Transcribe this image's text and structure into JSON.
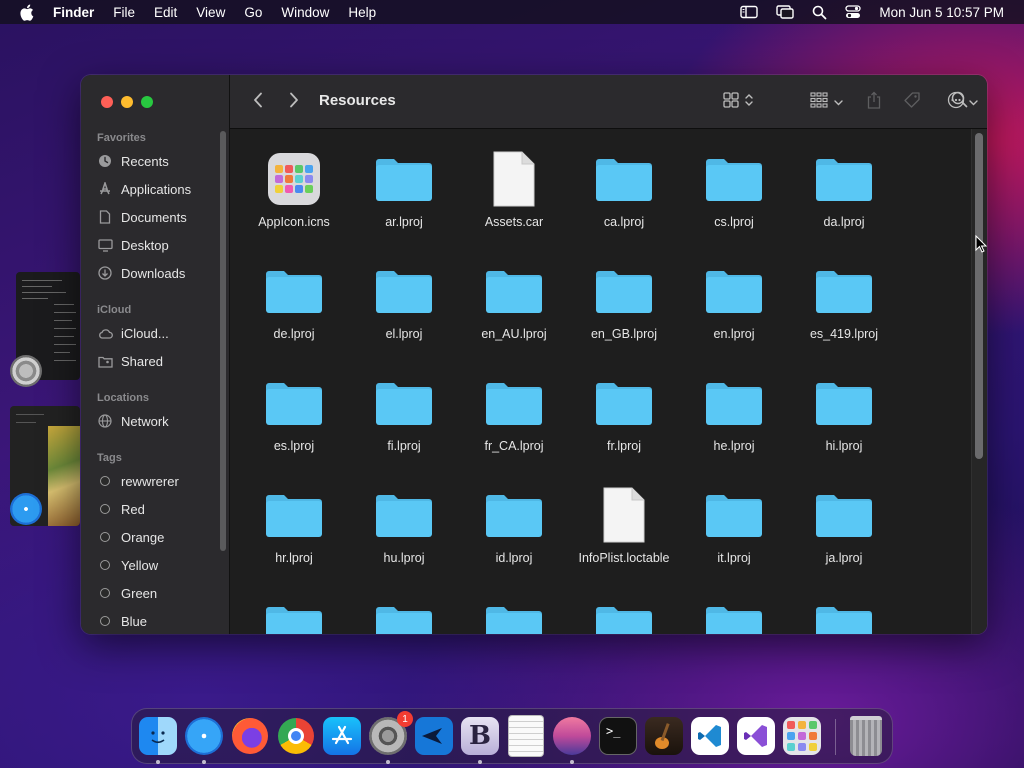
{
  "menubar": {
    "app_name": "Finder",
    "menus": [
      "File",
      "Edit",
      "View",
      "Go",
      "Window",
      "Help"
    ],
    "clock": "Mon Jun 5  10:57 PM",
    "status_icons": [
      "sidebar-list-icon",
      "screen-mirroring-icon",
      "spotlight-search-icon",
      "control-center-icon"
    ]
  },
  "window": {
    "title": "Resources"
  },
  "sidebar": {
    "favorites_header": "Favorites",
    "favorites": [
      {
        "label": "Recents",
        "icon": "clock-icon"
      },
      {
        "label": "Applications",
        "icon": "applications-icon"
      },
      {
        "label": "Documents",
        "icon": "document-icon"
      },
      {
        "label": "Desktop",
        "icon": "desktop-icon"
      },
      {
        "label": "Downloads",
        "icon": "download-icon"
      }
    ],
    "icloud_header": "iCloud",
    "icloud": [
      {
        "label": "iCloud...",
        "icon": "cloud-icon"
      },
      {
        "label": "Shared",
        "icon": "shared-folder-icon"
      }
    ],
    "locations_header": "Locations",
    "locations": [
      {
        "label": "Network",
        "icon": "globe-icon"
      }
    ],
    "tags_header": "Tags",
    "tags": [
      {
        "label": "rewwrerer"
      },
      {
        "label": "Red"
      },
      {
        "label": "Orange"
      },
      {
        "label": "Yellow"
      },
      {
        "label": "Green"
      },
      {
        "label": "Blue"
      }
    ]
  },
  "files": [
    {
      "name": "AppIcon.icns",
      "kind": "icns"
    },
    {
      "name": "ar.lproj",
      "kind": "folder"
    },
    {
      "name": "Assets.car",
      "kind": "document"
    },
    {
      "name": "ca.lproj",
      "kind": "folder"
    },
    {
      "name": "cs.lproj",
      "kind": "folder"
    },
    {
      "name": "da.lproj",
      "kind": "folder"
    },
    {
      "name": "de.lproj",
      "kind": "folder"
    },
    {
      "name": "el.lproj",
      "kind": "folder"
    },
    {
      "name": "en_AU.lproj",
      "kind": "folder"
    },
    {
      "name": "en_GB.lproj",
      "kind": "folder"
    },
    {
      "name": "en.lproj",
      "kind": "folder"
    },
    {
      "name": "es_419.lproj",
      "kind": "folder"
    },
    {
      "name": "es.lproj",
      "kind": "folder"
    },
    {
      "name": "fi.lproj",
      "kind": "folder"
    },
    {
      "name": "fr_CA.lproj",
      "kind": "folder"
    },
    {
      "name": "fr.lproj",
      "kind": "folder"
    },
    {
      "name": "he.lproj",
      "kind": "folder"
    },
    {
      "name": "hi.lproj",
      "kind": "folder"
    },
    {
      "name": "hr.lproj",
      "kind": "folder"
    },
    {
      "name": "hu.lproj",
      "kind": "folder"
    },
    {
      "name": "id.lproj",
      "kind": "folder"
    },
    {
      "name": "InfoPlist.loctable",
      "kind": "document"
    },
    {
      "name": "it.lproj",
      "kind": "folder"
    },
    {
      "name": "ja.lproj",
      "kind": "folder"
    },
    {
      "name": "",
      "kind": "folder"
    },
    {
      "name": "",
      "kind": "folder"
    },
    {
      "name": "",
      "kind": "folder"
    },
    {
      "name": "",
      "kind": "folder"
    },
    {
      "name": "",
      "kind": "folder"
    },
    {
      "name": "",
      "kind": "folder"
    }
  ],
  "dock": {
    "apps": [
      {
        "name": "finder-icon",
        "running": true
      },
      {
        "name": "safari-icon",
        "running": true
      },
      {
        "name": "firefox-icon",
        "running": false
      },
      {
        "name": "chrome-icon",
        "running": false
      },
      {
        "name": "app-store-icon",
        "running": false
      },
      {
        "name": "system-settings-icon",
        "running": true,
        "badge": "1"
      },
      {
        "name": "xcode-instruments-icon",
        "running": false
      },
      {
        "name": "bbedit-icon",
        "running": true
      },
      {
        "name": "textedit-icon",
        "running": false
      },
      {
        "name": "macos-installer-icon",
        "running": true
      },
      {
        "name": "terminal-icon",
        "running": false
      },
      {
        "name": "garageband-icon",
        "running": false
      },
      {
        "name": "vscode-icon",
        "running": false
      },
      {
        "name": "visual-studio-icon",
        "running": false
      },
      {
        "name": "launchpad-icon",
        "running": false
      },
      {
        "name": "trash-icon",
        "running": false
      }
    ]
  },
  "colors": {
    "folder": "#5ac8f5",
    "folder_tab": "#4fb8e6",
    "sidebar_bg": "#2b2a2d",
    "content_bg": "#1e1e1e"
  }
}
